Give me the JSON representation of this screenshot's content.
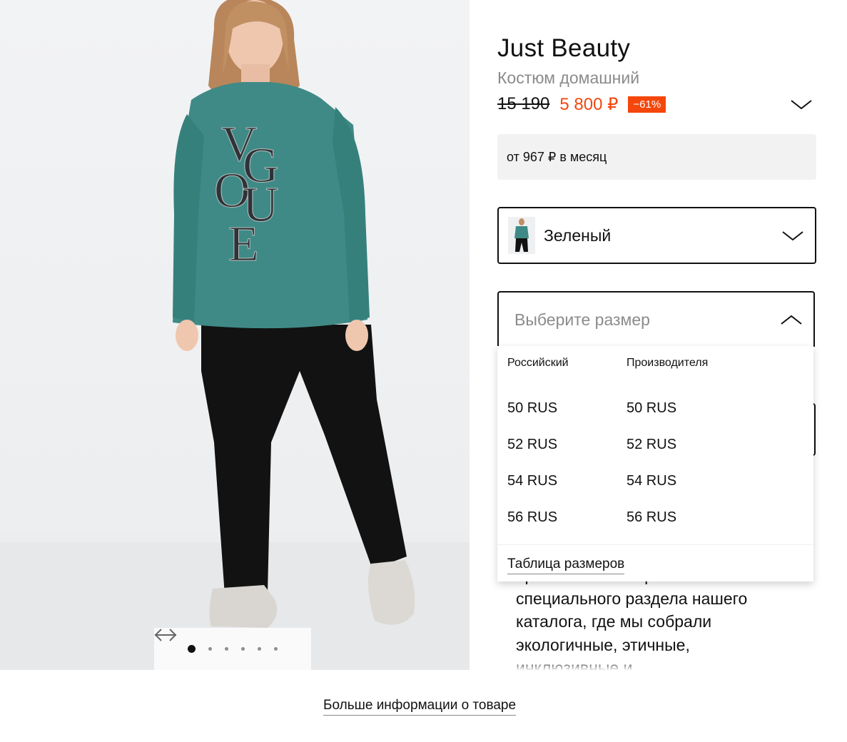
{
  "product": {
    "brand": "Just Beauty",
    "subtitle": "Костюм домашний",
    "old_price": "15 190",
    "new_price": "5 800 ₽",
    "discount": "−61%",
    "installment": "от 967 ₽ в месяц"
  },
  "color_select": {
    "selected": "Зеленый"
  },
  "size_select": {
    "placeholder": "Выберите размер",
    "headers": [
      "Российский",
      "Производителя"
    ],
    "options": [
      {
        "russian": "50 RUS",
        "manufacturer": "50 RUS"
      },
      {
        "russian": "52 RUS",
        "manufacturer": "52 RUS"
      },
      {
        "russian": "54 RUS",
        "manufacturer": "54 RUS"
      },
      {
        "russian": "56 RUS",
        "manufacturer": "56 RUS"
      }
    ],
    "size_table_link": "Таблица размеров"
  },
  "description_lines": [
    "проекта Lamoda planet –",
    "специального раздела нашего",
    "каталога, где мы собрали",
    "экологичные, этичные,",
    "инклюзивные и"
  ],
  "gallery": {
    "total_images": 6,
    "active_index": 0
  },
  "more_info_link": "Больше информации о товаре",
  "colors": {
    "accent": "#f5460b",
    "sweater": "#3f8a86",
    "pants": "#121212"
  }
}
